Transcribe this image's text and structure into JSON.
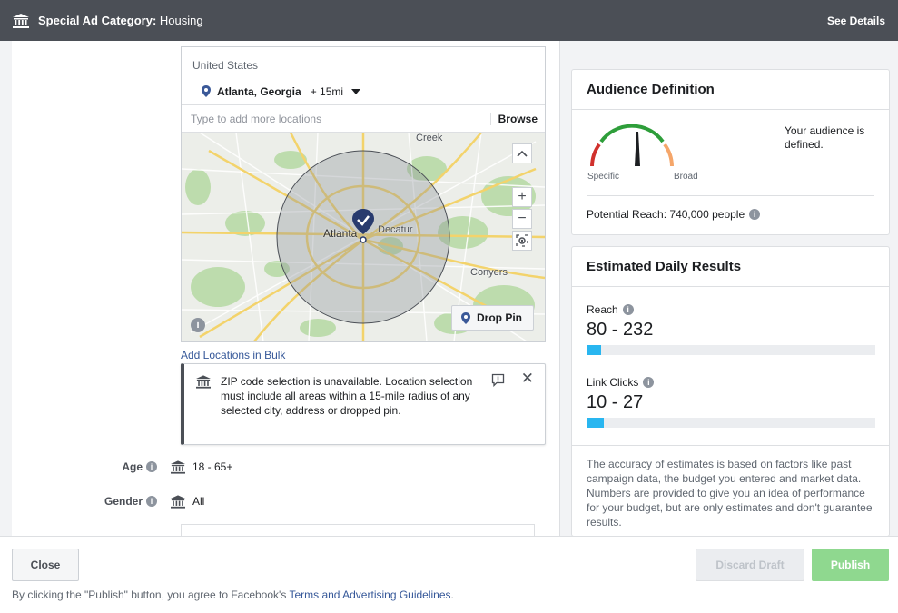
{
  "header": {
    "category_label": "Special Ad Category:",
    "category_value": "Housing",
    "see_details": "See Details",
    "icon": "bank-icon"
  },
  "location": {
    "country": "United States",
    "city": "Atlanta, Georgia",
    "radius": "+ 15mi",
    "add_placeholder": "Type to add more locations",
    "browse_label": "Browse",
    "map_labels": [
      "Creek",
      "Atlanta",
      "Decatur",
      "Conyers"
    ],
    "drop_pin_label": "Drop Pin",
    "bulk_link": "Add Locations in Bulk",
    "zoom_in": "+",
    "zoom_out": "−"
  },
  "notice": {
    "text": "ZIP code selection is unavailable. Location selection must include all areas within a 15-mile radius of any selected city, address or dropped pin.",
    "close": "✕"
  },
  "targeting": {
    "age_label": "Age",
    "age_value": "18 - 65+",
    "gender_label": "Gender",
    "gender_value": "All"
  },
  "audience": {
    "title": "Audience Definition",
    "specific": "Specific",
    "broad": "Broad",
    "status": "Your audience is defined.",
    "potential_reach": "Potential Reach: 740,000 people"
  },
  "estimates": {
    "title": "Estimated Daily Results",
    "reach_label": "Reach",
    "reach_value": "80 - 232",
    "reach_fill": 0.05,
    "clicks_label": "Link Clicks",
    "clicks_value": "10 - 27",
    "clicks_fill": 0.06,
    "disclaimer": "The accuracy of estimates is based on factors like past campaign data, the budget you entered and market data. Numbers are provided to give you an idea of performance for your budget, but are only estimates and don't guarantee results."
  },
  "footer": {
    "close": "Close",
    "discard": "Discard Draft",
    "publish": "Publish",
    "terms_prefix": "By clicking the \"Publish\" button, you agree to Facebook's ",
    "terms_link": "Terms and Advertising Guidelines",
    "terms_suffix": "."
  },
  "colors": {
    "topbar": "#4b4f56",
    "link": "#365899",
    "bar_fill": "#29b6f0",
    "publish": "#8fd88f",
    "gauge_green": "#2e9e3a",
    "gauge_red": "#d0312d",
    "gauge_orange": "#f5a66a"
  }
}
